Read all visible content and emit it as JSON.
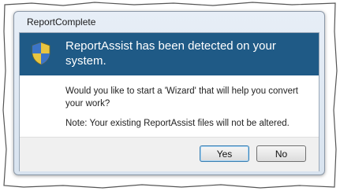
{
  "window": {
    "title": "ReportComplete"
  },
  "banner": {
    "icon": "uac-shield-icon",
    "heading": "ReportAssist has been detected on your system."
  },
  "body": {
    "question": "Would you like to start a 'Wizard' that will help you convert your work?",
    "note": "Note: Your existing ReportAssist files will not be altered."
  },
  "buttons": {
    "yes": "Yes",
    "no": "No"
  },
  "colors": {
    "banner": "#1f5a86",
    "frame": "#d8e3ef"
  }
}
